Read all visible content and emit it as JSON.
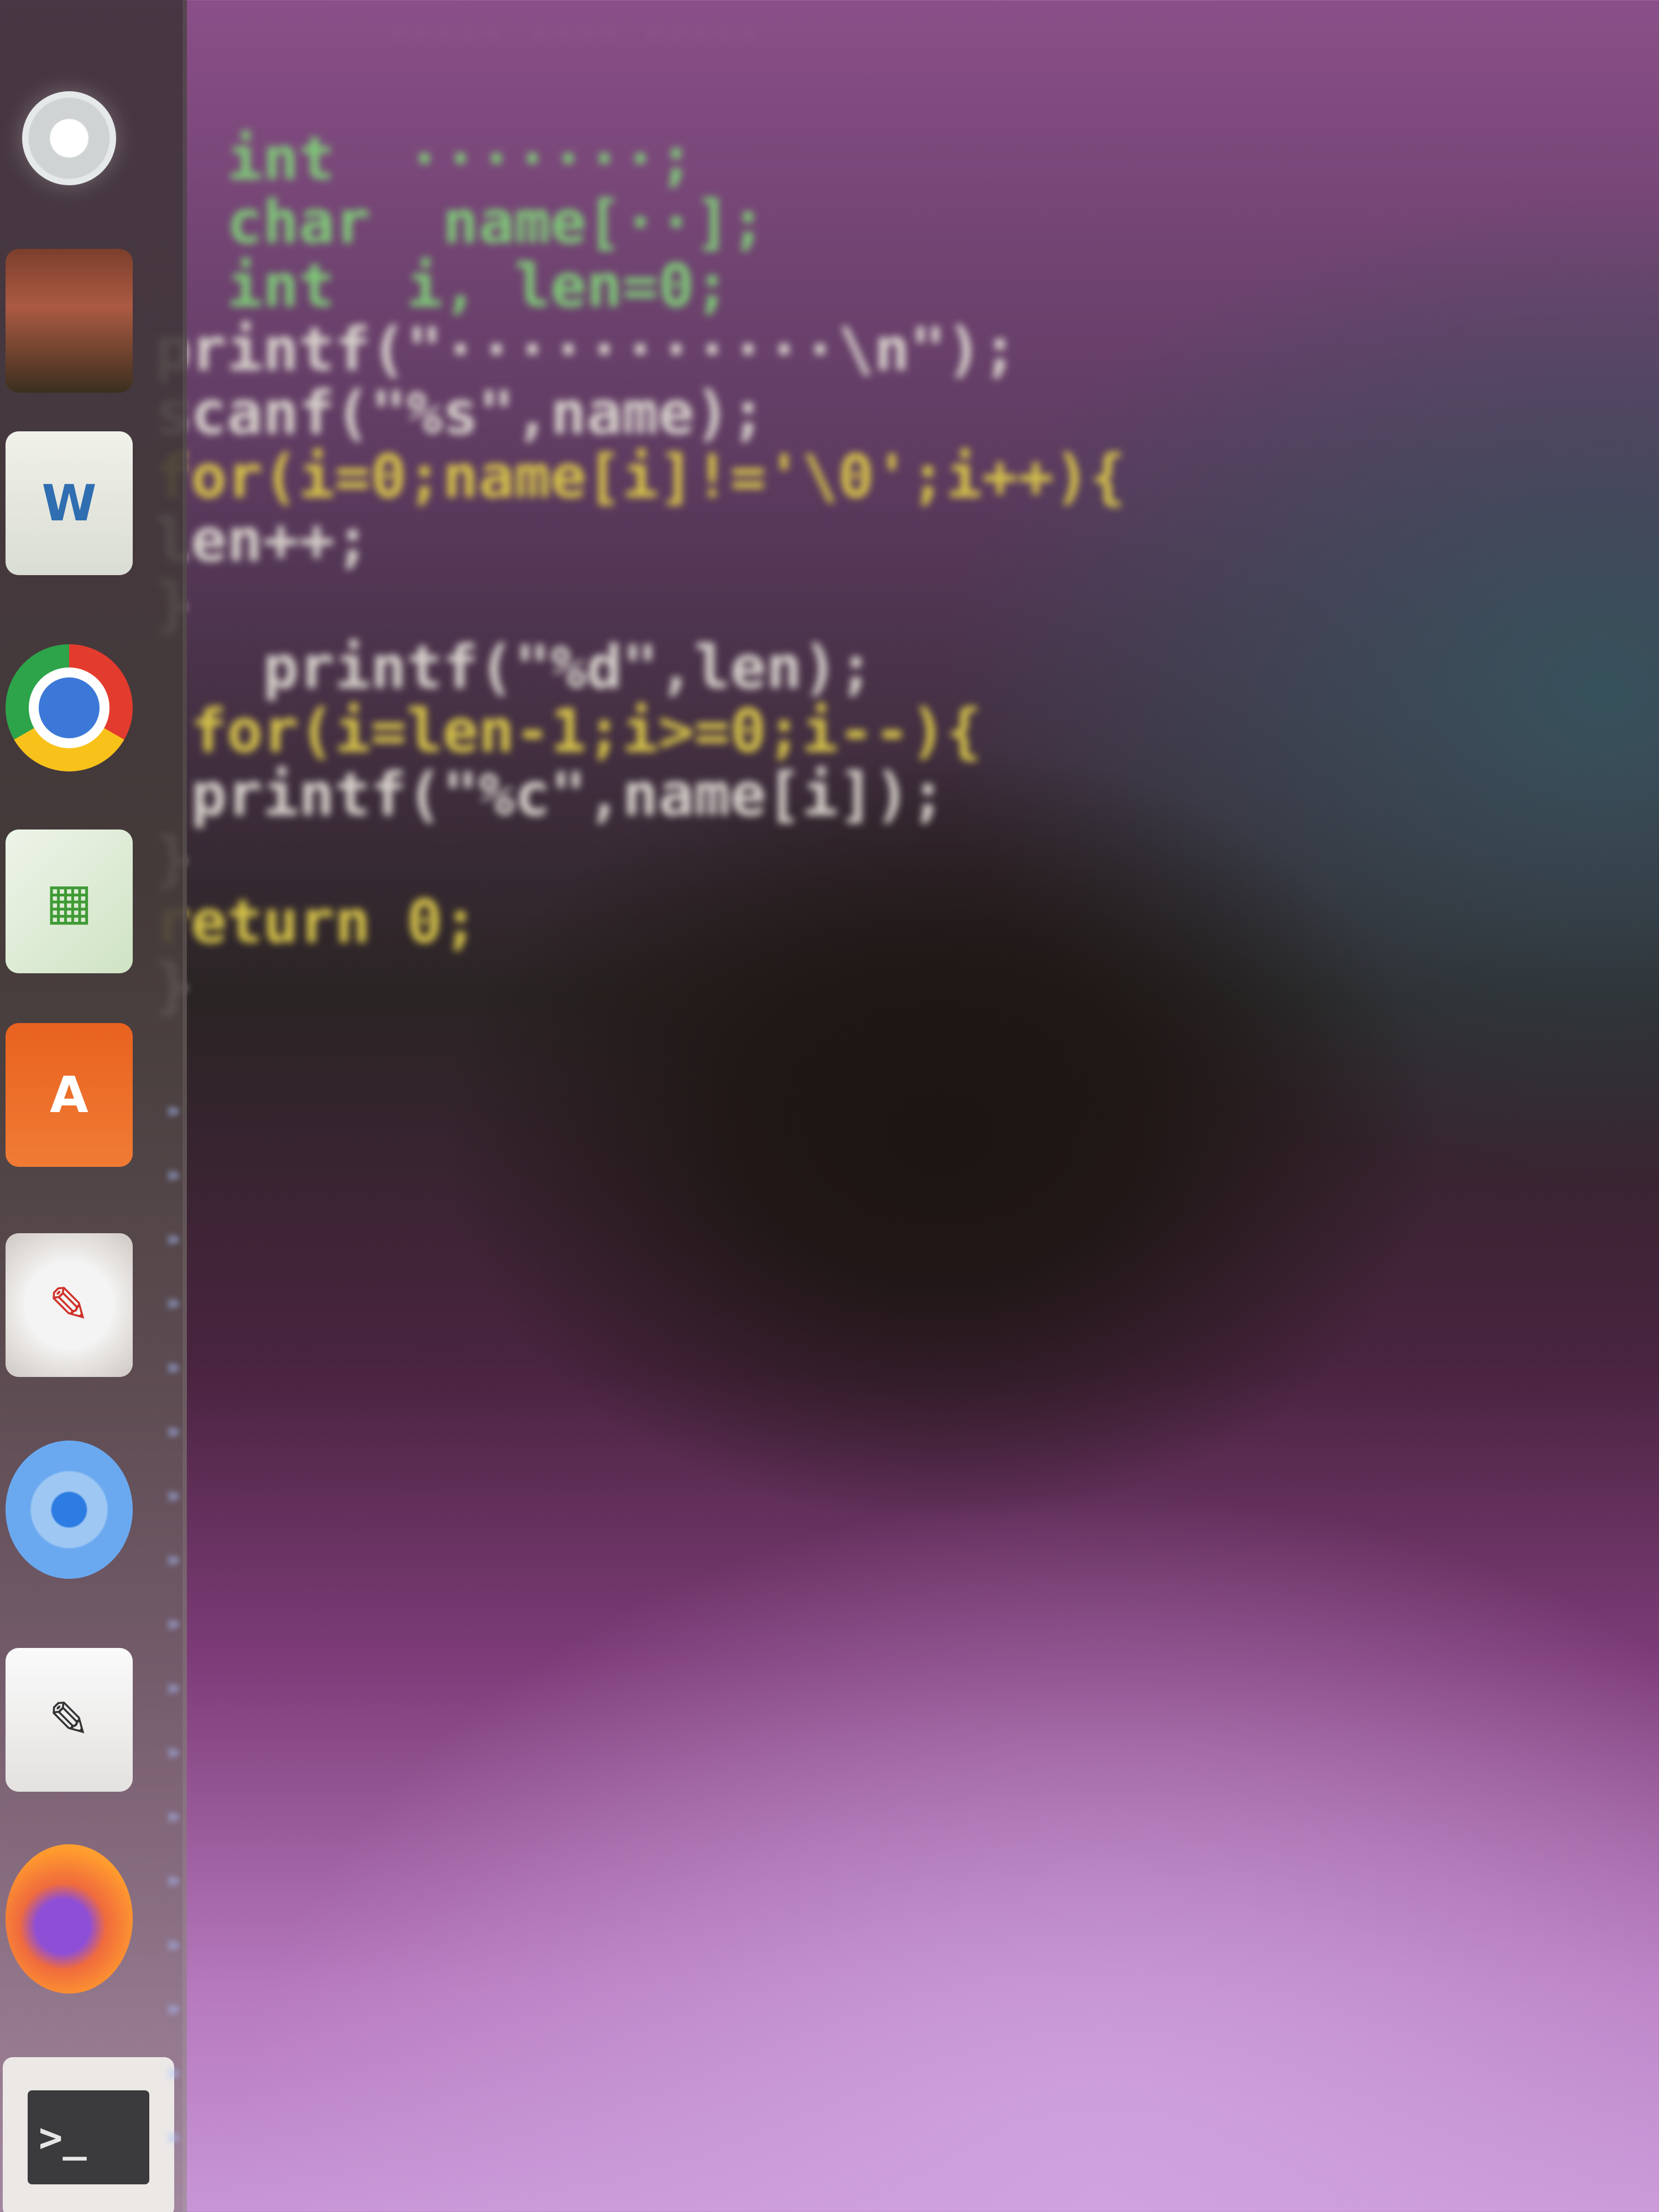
{
  "window": {
    "title_blurred": "·····  ····  ·····"
  },
  "launcher": {
    "items": [
      {
        "name": "dash",
        "icon": "ubuntu-dash-icon",
        "glyph": ""
      },
      {
        "name": "files",
        "icon": "files-icon",
        "glyph": ""
      },
      {
        "name": "writer",
        "icon": "document-icon",
        "glyph": "W"
      },
      {
        "name": "chrome",
        "icon": "chrome-icon",
        "glyph": ""
      },
      {
        "name": "calc",
        "icon": "spreadsheet-icon",
        "glyph": "▦"
      },
      {
        "name": "software",
        "icon": "software-center-icon",
        "glyph": "A"
      },
      {
        "name": "settings",
        "icon": "settings-icon",
        "glyph": "✎"
      },
      {
        "name": "chromium",
        "icon": "chromium-icon",
        "glyph": ""
      },
      {
        "name": "text-editor",
        "icon": "text-editor-icon",
        "glyph": "✎"
      },
      {
        "name": "firefox",
        "icon": "firefox-icon",
        "glyph": ""
      },
      {
        "name": "terminal",
        "icon": "terminal-icon",
        "glyph": ">_"
      }
    ]
  },
  "code": {
    "lines": [
      {
        "text": "  int  ·······;"
      },
      {
        "text": "  char  name[··];"
      },
      {
        "text": "  int  i, len=0;"
      },
      {
        "text": "printf(\"···········\\n\");"
      },
      {
        "text": "scanf(\"%s\",name);"
      },
      {
        "text": "for(i=0;name[i]!='\\0';i++){"
      },
      {
        "text": "len++;"
      },
      {
        "text": "}"
      },
      {
        "text": "   printf(\"%d\",len);"
      },
      {
        "text": " for(i=len-1;i>=0;i--){"
      },
      {
        "text": " printf(\"%c\",name[i]);"
      },
      {
        "text": "}"
      },
      {
        "text": "return 0;"
      },
      {
        "text": "}"
      }
    ]
  },
  "colors": {
    "keyword": "#d7c44a",
    "type": "#7fc978",
    "string": "#e06a4a",
    "text": "#d8d2cc"
  }
}
